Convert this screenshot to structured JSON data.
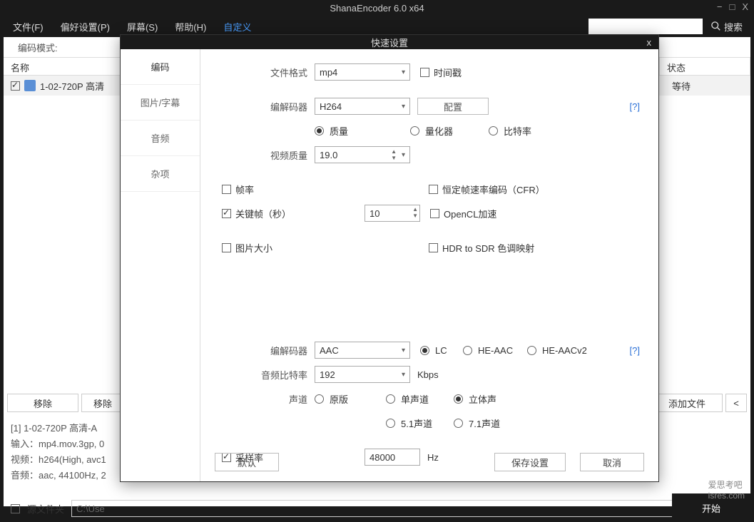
{
  "title": "ShanaEncoder 6.0 x64",
  "menu": {
    "file": "文件(F)",
    "prefs": "偏好设置(P)",
    "screen": "屏幕(S)",
    "help": "帮助(H)",
    "custom": "自定义",
    "search": "搜索"
  },
  "top": {
    "encode_mode": "编码模式:"
  },
  "table": {
    "name_header": "名称",
    "status_header": "状态"
  },
  "file": {
    "name": "1-02-720P 高清",
    "status": "等待"
  },
  "buttons": {
    "remove": "移除",
    "remove2": "移除",
    "addfile": "添加文件",
    "lt": "<"
  },
  "info": {
    "l1": "[1] 1-02-720P 高清-A",
    "l2": "输入：mp4.mov.3gp, 0",
    "l3": "视频：h264(High, avc1",
    "l4": "音频：aac, 44100Hz, 2"
  },
  "path": {
    "label": "源文件夹",
    "value": "C:\\Use"
  },
  "start": "开始",
  "watermark": "爱思考吧\nisres.com",
  "modal": {
    "title": "快速设置",
    "tabs": {
      "encode": "编码",
      "subtitle": "图片/字幕",
      "audio": "音频",
      "misc": "杂项"
    },
    "file_format_lbl": "文件格式",
    "file_format": "mp4",
    "timestamp": "时间戳",
    "codec_lbl": "编解码器",
    "codec": "H264",
    "config": "配置",
    "help": "[?]",
    "mode": {
      "quality": "质量",
      "quantizer": "量化器",
      "bitrate": "比特率"
    },
    "vq_lbl": "视频质量",
    "vq": "19.0",
    "fps": "帧率",
    "cfr": "恒定帧速率编码（CFR）",
    "keyframe": "关键帧（秒）",
    "keyframe_val": "10",
    "opencl": "OpenCL加速",
    "imgsize": "图片大小",
    "hdr": "HDR to SDR 色调映射",
    "acodec_lbl": "编解码器",
    "acodec": "AAC",
    "aac": {
      "lc": "LC",
      "he": "HE-AAC",
      "hev2": "HE-AACv2"
    },
    "abitrate_lbl": "音频比特率",
    "abitrate": "192",
    "kbps": "Kbps",
    "channel_lbl": "声道",
    "ch": {
      "orig": "原版",
      "mono": "单声道",
      "stereo": "立体声",
      "s51": "5.1声道",
      "s71": "7.1声道"
    },
    "sample_lbl": "采样率",
    "sample": "48000",
    "hz": "Hz",
    "default": "默认",
    "save": "保存设置",
    "cancel": "取消"
  }
}
